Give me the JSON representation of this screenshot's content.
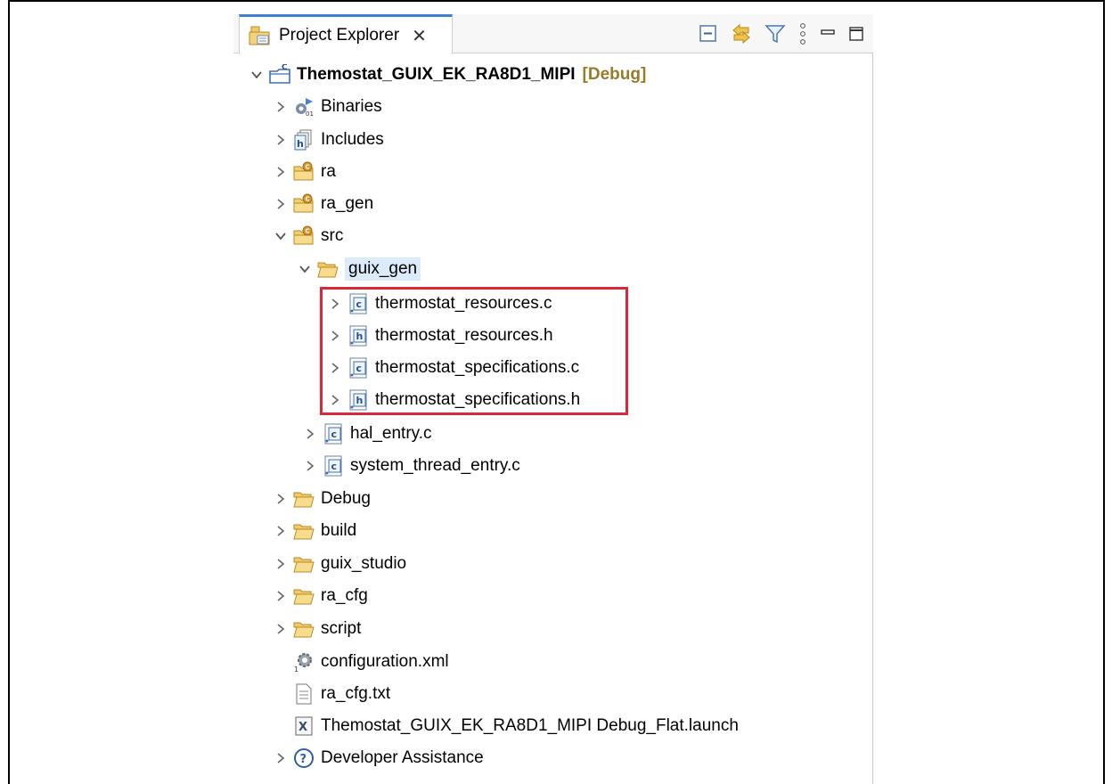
{
  "view": {
    "tab_label": "Project Explorer",
    "close_glyph": "✕"
  },
  "project": {
    "name": "Themostat_GUIX_EK_RA8D1_MIPI",
    "tag": "[Debug]"
  },
  "tree": {
    "binaries": "Binaries",
    "includes": "Includes",
    "ra": "ra",
    "ra_gen": "ra_gen",
    "src": "src",
    "guix_gen": "guix_gen",
    "files": {
      "f1": "thermostat_resources.c",
      "f2": "thermostat_resources.h",
      "f3": "thermostat_specifications.c",
      "f4": "thermostat_specifications.h",
      "hal": "hal_entry.c",
      "sys": "system_thread_entry.c"
    },
    "debug": "Debug",
    "build": "build",
    "guix_studio": "guix_studio",
    "ra_cfg": "ra_cfg",
    "script": "script",
    "configuration": "configuration.xml",
    "ra_cfg_txt": "ra_cfg.txt",
    "launch": "Themostat_GUIX_EK_RA8D1_MIPI Debug_Flat.launch",
    "assistance": "Developer Assistance"
  },
  "colors": {
    "highlight": "#d9283a",
    "folder": "#e8b84a",
    "source_folder": "#d99a2b",
    "tag": "#9a7b2a",
    "accent": "#3f7fd1"
  },
  "icons": [
    "project-explorer-icon",
    "collapse-all-icon",
    "link-editor-icon",
    "filter-icon",
    "view-menu-icon",
    "minimize-icon",
    "maximize-icon"
  ]
}
